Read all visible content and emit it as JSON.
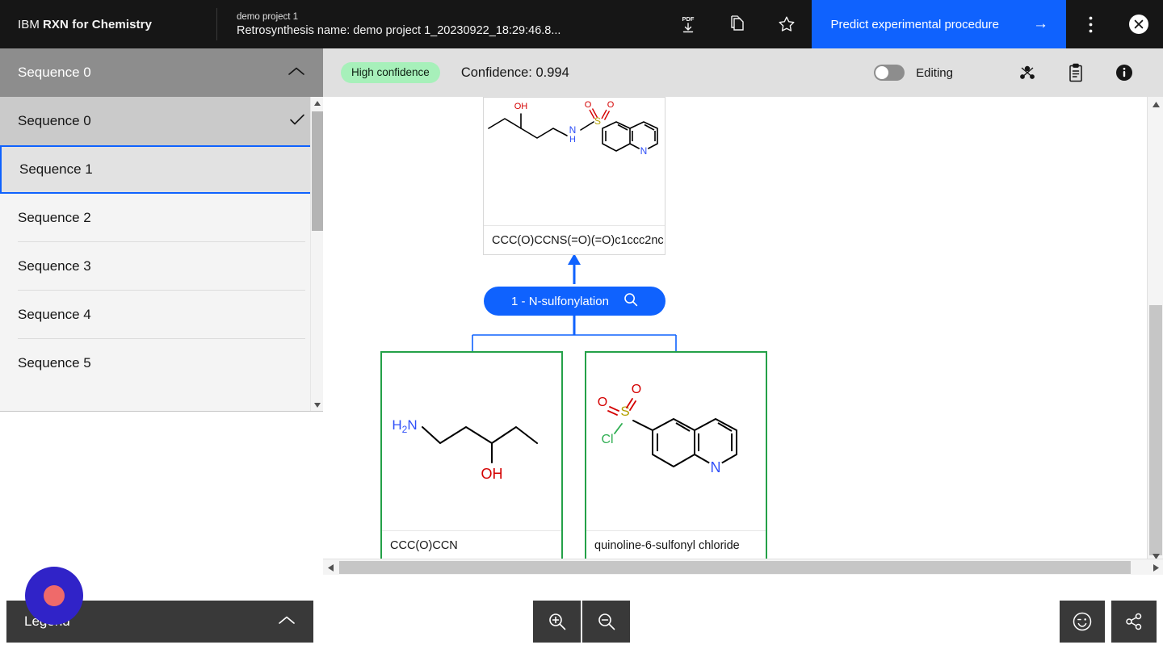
{
  "header": {
    "brand_prefix": "IBM",
    "brand_name": "RXN for Chemistry",
    "project_name": "demo project 1",
    "retro_title": "Retrosynthesis name: demo project 1_20230922_18:29:46.8...",
    "icons": [
      "pdf-download-icon",
      "copy-icon",
      "star-icon"
    ],
    "predict_button": "Predict experimental procedure",
    "predict_arrow": "→",
    "overflow_icon": "kebab-menu-icon",
    "close_icon": "close-icon",
    "accent_color": "#0f62fe",
    "background_color": "#161616"
  },
  "sequence_panel": {
    "selected": "Sequence 0",
    "collapse_icon": "chevron-up-icon",
    "items": [
      {
        "label": "Sequence 0",
        "checked": true,
        "focused": false
      },
      {
        "label": "Sequence 1",
        "checked": false,
        "focused": true
      },
      {
        "label": "Sequence 2",
        "checked": false,
        "focused": false
      },
      {
        "label": "Sequence 3",
        "checked": false,
        "focused": false
      },
      {
        "label": "Sequence 4",
        "checked": false,
        "focused": false
      },
      {
        "label": "Sequence 5",
        "checked": false,
        "focused": false
      }
    ],
    "check_icon": "check-icon",
    "focus_color": "#0f62fe"
  },
  "toolbar": {
    "confidence_badge": "High confidence",
    "confidence_text": "Confidence: 0.994",
    "confidence_value": 0.994,
    "badge_color": "#a7f0ba",
    "editing_label": "Editing",
    "editing_on": false,
    "icons": [
      "graph-nodes-icon",
      "clipboard-icon",
      "info-filled-icon"
    ]
  },
  "canvas": {
    "reaction_pill": {
      "label": "1 - N-sulfonylation",
      "search_icon": "magnifier-icon",
      "color": "#0f62fe"
    },
    "product": {
      "smiles_caption": "CCC(O)CCNS(=O)(=O)c1ccc2nc...",
      "border_color": "#d8d8d8",
      "atom_labels": [
        "OH",
        "N",
        "H",
        "S",
        "O",
        "O",
        "N"
      ]
    },
    "precursors": [
      {
        "caption": "CCC(O)CCN",
        "border_color": "#24a148",
        "atom_labels": [
          "H2N",
          "OH"
        ]
      },
      {
        "caption": "quinoline-6-sulfonyl chloride",
        "border_color": "#24a148",
        "atom_labels": [
          "O",
          "O",
          "S",
          "Cl",
          "N"
        ]
      }
    ],
    "connector_color": "#0f62fe"
  },
  "bottom_bar": {
    "legend_label": "Legend",
    "legend_chevron": "chevron-up-icon",
    "zoom_in_icon": "zoom-in-icon",
    "zoom_out_icon": "zoom-out-icon",
    "feedback_icon": "wink-face-icon",
    "share_icon": "share-icon"
  },
  "scrollbars": {
    "vertical": "vertical-scrollbar",
    "horizontal": "horizontal-scrollbar",
    "up_arrow": "▲",
    "down_arrow": "▼",
    "left_arrow": "◀",
    "right_arrow": "▶"
  }
}
